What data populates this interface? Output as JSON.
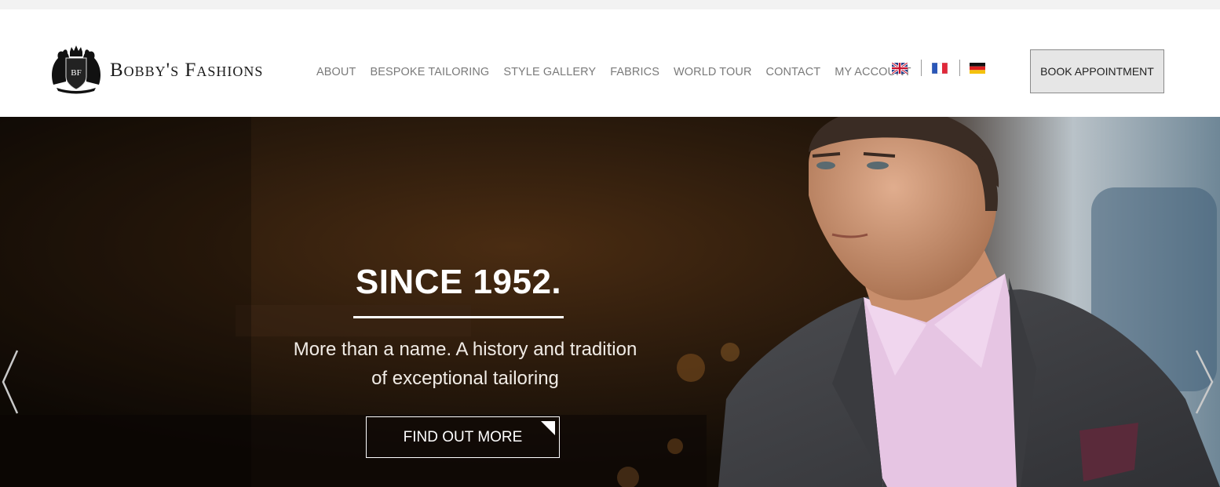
{
  "brand": {
    "name": "Bobby's Fashions",
    "crest_initials": "BF"
  },
  "nav": {
    "items": [
      {
        "label": "ABOUT"
      },
      {
        "label": "BESPOKE TAILORING"
      },
      {
        "label": "STYLE GALLERY"
      },
      {
        "label": "FABRICS"
      },
      {
        "label": "WORLD TOUR"
      },
      {
        "label": "CONTACT"
      },
      {
        "label": "MY ACCOUNT"
      }
    ]
  },
  "languages": [
    {
      "code": "en",
      "icon": "uk-flag-icon"
    },
    {
      "code": "fr",
      "icon": "france-flag-icon"
    },
    {
      "code": "de",
      "icon": "germany-flag-icon"
    }
  ],
  "header": {
    "cta_label": "BOOK APPOINTMENT"
  },
  "hero": {
    "title": "SINCE 1952.",
    "subtitle_line1": "More than a name. A history and tradition",
    "subtitle_line2": "of exceptional tailoring",
    "button_label": "FIND OUT MORE",
    "prev_icon": "chevron-left-icon",
    "next_icon": "chevron-right-icon"
  },
  "colors": {
    "nav_text": "#7a7a7a",
    "button_bg": "#e6e6e6",
    "hero_text": "#ffffff"
  }
}
